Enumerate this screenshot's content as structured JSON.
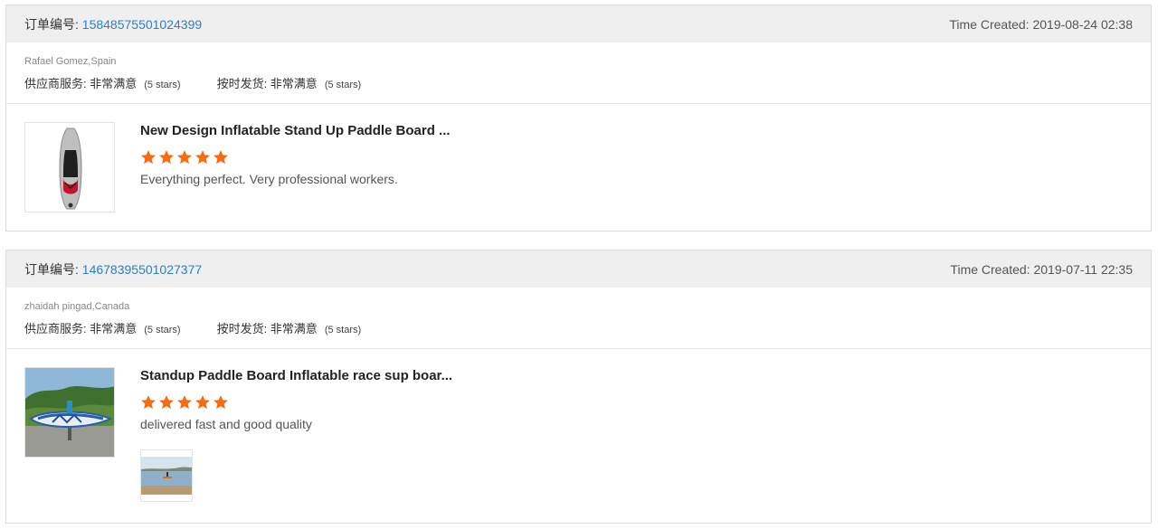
{
  "reviews": [
    {
      "order_label": "订单编号: ",
      "order_id": "15848575501024399",
      "time_created": "Time Created: 2019-08-24 02:38",
      "buyer": "Rafael Gomez,Spain",
      "ratings": [
        {
          "label": "供应商服务: 非常满意",
          "stars_note": "(5 stars)"
        },
        {
          "label": "按时发货: 非常满意",
          "stars_note": "(5 stars)"
        }
      ],
      "product_title": "New Design Inflatable Stand Up Paddle Board ...",
      "star_count": 5,
      "review_text": "Everything perfect. Very professional workers."
    },
    {
      "order_label": "订单编号: ",
      "order_id": "14678395501027377",
      "time_created": "Time Created: 2019-07-11 22:35",
      "buyer": "zhaidah pingad,Canada",
      "ratings": [
        {
          "label": "供应商服务: 非常满意",
          "stars_note": "(5 stars)"
        },
        {
          "label": "按时发货: 非常满意",
          "stars_note": "(5 stars)"
        }
      ],
      "product_title": "Standup Paddle Board Inflatable race sup boar...",
      "star_count": 5,
      "review_text": "delivered fast and good quality"
    }
  ],
  "colors": {
    "star": "#f76b15",
    "link": "#2b80c5",
    "header_bg": "#efefef"
  },
  "icons": {
    "star": "star-icon"
  }
}
